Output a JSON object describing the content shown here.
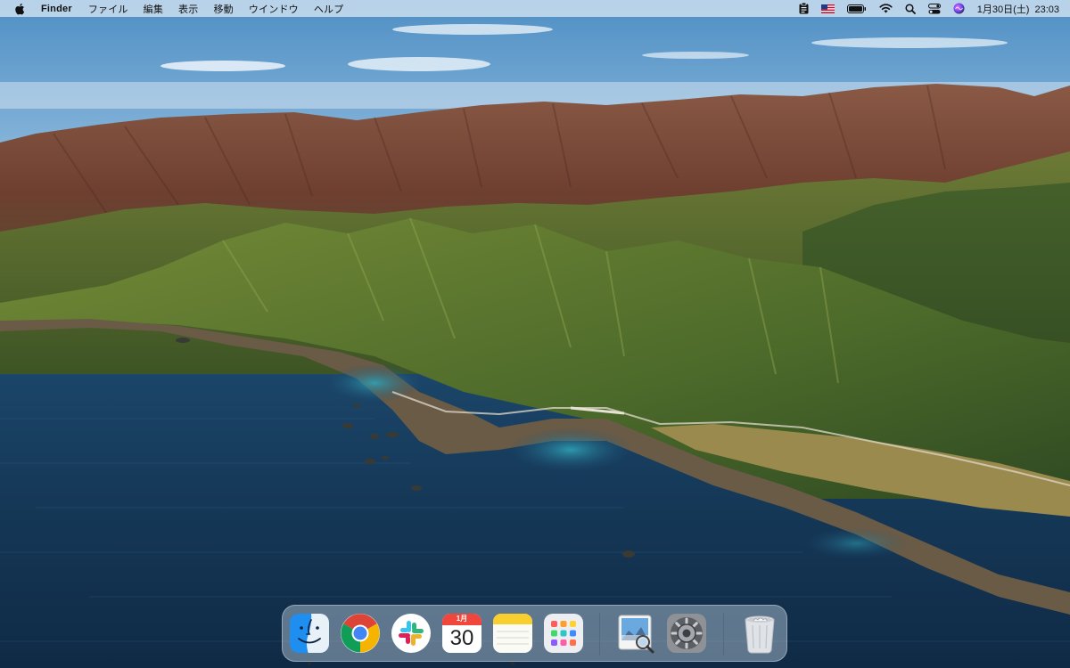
{
  "menubar": {
    "app_name": "Finder",
    "menus": [
      "ファイル",
      "編集",
      "表示",
      "移動",
      "ウインドウ",
      "ヘルプ"
    ],
    "status_icons": [
      "clipboard-icon",
      "us-flag-icon",
      "battery-icon",
      "wifi-icon",
      "search-icon",
      "control-center-icon",
      "siri-icon"
    ],
    "date": "1月30日(土)",
    "time": "23:03"
  },
  "dock": {
    "apps": [
      {
        "name": "Finder",
        "icon": "finder-icon",
        "running": true
      },
      {
        "name": "Google Chrome",
        "icon": "chrome-icon",
        "running": false
      },
      {
        "name": "Slack",
        "icon": "slack-icon",
        "running": false
      },
      {
        "name": "Calendar",
        "icon": "calendar-icon",
        "running": false
      },
      {
        "name": "Notes",
        "icon": "notes-icon",
        "running": true
      },
      {
        "name": "Launchpad",
        "icon": "launchpad-icon",
        "running": false
      },
      {
        "name": "Preview",
        "icon": "preview-icon",
        "running": false
      },
      {
        "name": "System Preferences",
        "icon": "system-preferences-icon",
        "running": false
      },
      {
        "name": "Trash",
        "icon": "trash-icon",
        "running": false
      }
    ],
    "calendar_month": "1月",
    "calendar_day": "30"
  },
  "colors": {
    "sea": "#163a5a",
    "sky": "#9fc3e0",
    "mountain_brown": "#7a4a36",
    "hill_green": "#4f6a2a",
    "chrome_red": "#db4437",
    "chrome_green": "#0f9d58",
    "chrome_yellow": "#f4b400",
    "chrome_blue": "#4285f4"
  }
}
